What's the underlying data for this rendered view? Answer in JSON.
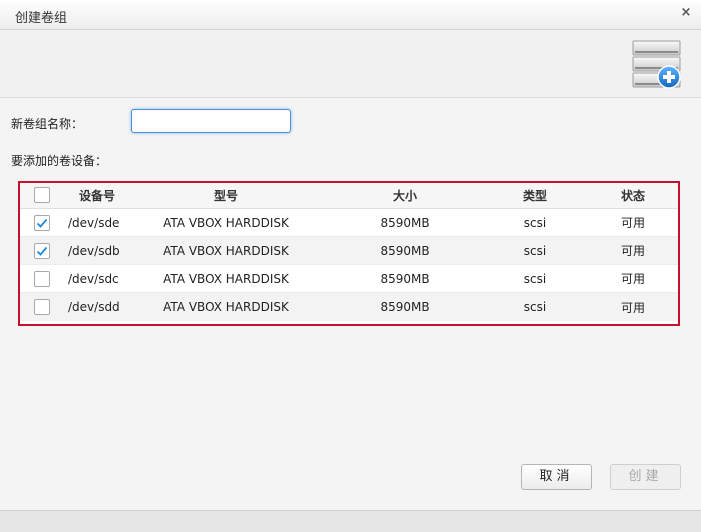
{
  "dialog": {
    "title": "创建卷组",
    "close_glyph": "×"
  },
  "form": {
    "name_label": "新卷组名称：",
    "name_value": "",
    "devices_label": "要添加的卷设备："
  },
  "table": {
    "headers": {
      "device": "设备号",
      "model": "型号",
      "size": "大小",
      "type": "类型",
      "status": "状态"
    },
    "rows": [
      {
        "checked": true,
        "device": "/dev/sde",
        "model": "ATA VBOX HARDDISK",
        "size": "8590MB",
        "type": "scsi",
        "status": "可用"
      },
      {
        "checked": true,
        "device": "/dev/sdb",
        "model": "ATA VBOX HARDDISK",
        "size": "8590MB",
        "type": "scsi",
        "status": "可用"
      },
      {
        "checked": false,
        "device": "/dev/sdc",
        "model": "ATA VBOX HARDDISK",
        "size": "8590MB",
        "type": "scsi",
        "status": "可用"
      },
      {
        "checked": false,
        "device": "/dev/sdd",
        "model": "ATA VBOX HARDDISK",
        "size": "8590MB",
        "type": "scsi",
        "status": "可用"
      }
    ]
  },
  "buttons": {
    "cancel": "取消",
    "create": "创建"
  },
  "icons": {
    "header": "volume-group-add-icon",
    "checkmark": "checkmark-icon"
  },
  "colors": {
    "highlight_border": "#c8102e",
    "accent_blue": "#1e88e5",
    "input_focus": "#4a90d9"
  }
}
